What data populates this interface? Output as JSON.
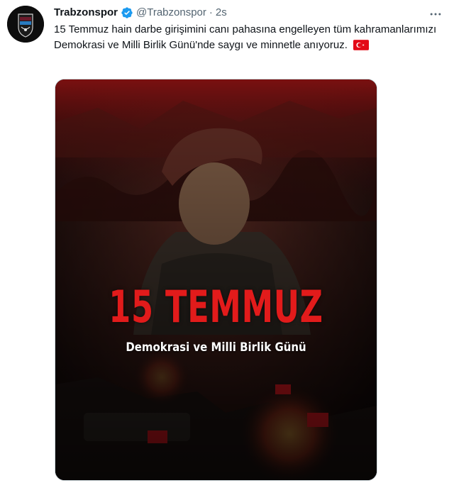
{
  "tweet": {
    "author_name": "Trabzonspor",
    "handle": "@Trabzonspor",
    "separator": "·",
    "time": "2s",
    "text": "15 Temmuz hain darbe girişimini canı pahasına engelleyen tüm kahramanlarımızı Demokrasi ve Milli Birlik Günü'nde saygı ve minnetle anıyoruz.",
    "more_icon": "more-horizontal-icon",
    "verified_icon": "verified-badge-icon"
  },
  "poster": {
    "title": "15 TEMMUZ",
    "subtitle": "Demokrasi ve Milli Birlik Günü"
  },
  "colors": {
    "verified_blue": "#1d9bf0",
    "poster_red": "#e21b1b",
    "secondary_text": "#536471"
  }
}
